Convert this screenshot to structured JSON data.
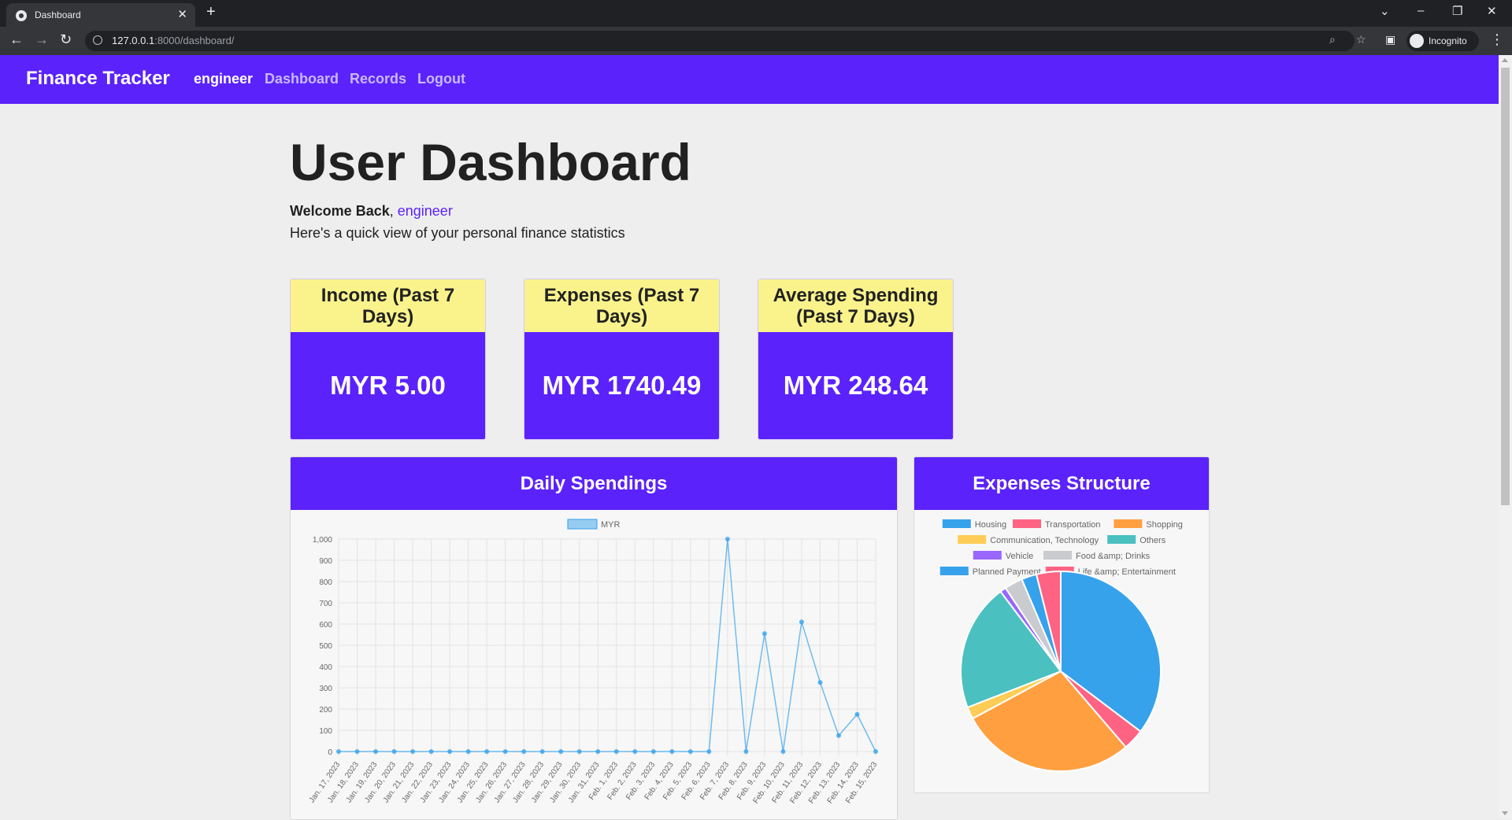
{
  "browser": {
    "tab_title": "Dashboard",
    "url_host": "127.0.0.1",
    "url_path": ":8000/dashboard/",
    "profile_label": "Incognito"
  },
  "navbar": {
    "brand": "Finance Tracker",
    "username": "engineer",
    "links": [
      "Dashboard",
      "Records",
      "Logout"
    ]
  },
  "header": {
    "title": "User Dashboard",
    "welcome_prefix": "Welcome Back",
    "welcome_user": "engineer",
    "subtitle": "Here's a quick view of your personal finance statistics"
  },
  "stats": [
    {
      "label": "Income (Past 7 Days)",
      "value": "MYR 5.00"
    },
    {
      "label": "Expenses (Past 7 Days)",
      "value": "MYR 1740.49"
    },
    {
      "label": "Average Spending (Past 7 Days)",
      "value": "MYR 248.64"
    }
  ],
  "colors": {
    "brand": "#5b22fb",
    "card_header": "#faf38c",
    "line": "#36a2eb"
  },
  "icons": {
    "back": "arrow-left-icon",
    "forward": "arrow-right-icon",
    "reload": "reload-icon",
    "zoom": "magnifier-icon",
    "bookmark": "star-icon",
    "sidepanel": "side-panel-icon",
    "menu": "kebab-menu-icon"
  },
  "chart_data": [
    {
      "type": "line",
      "title": "Daily Spendings",
      "ylim": [
        0,
        1000
      ],
      "y_ticks": [
        0,
        100,
        200,
        300,
        400,
        500,
        600,
        700,
        800,
        900,
        1000
      ],
      "grid": true,
      "legend_position": "top",
      "categories": [
        "Jan. 17, 2023",
        "Jan. 18, 2023",
        "Jan. 19, 2023",
        "Jan. 20, 2023",
        "Jan. 21, 2023",
        "Jan. 22, 2023",
        "Jan. 23, 2023",
        "Jan. 24, 2023",
        "Jan. 25, 2023",
        "Jan. 26, 2023",
        "Jan. 27, 2023",
        "Jan. 28, 2023",
        "Jan. 29, 2023",
        "Jan. 30, 2023",
        "Jan. 31, 2023",
        "Feb. 1, 2023",
        "Feb. 2, 2023",
        "Feb. 3, 2023",
        "Feb. 4, 2023",
        "Feb. 5, 2023",
        "Feb. 6, 2023",
        "Feb. 7, 2023",
        "Feb. 8, 2023",
        "Feb. 9, 2023",
        "Feb. 10, 2023",
        "Feb. 11, 2023",
        "Feb. 12, 2023",
        "Feb. 13, 2023",
        "Feb. 14, 2023",
        "Feb. 15, 2023"
      ],
      "series": [
        {
          "name": "MYR",
          "values": [
            0,
            0,
            0,
            0,
            0,
            0,
            0,
            0,
            0,
            0,
            0,
            0,
            0,
            0,
            0,
            0,
            0,
            0,
            0,
            0,
            0,
            1000,
            0,
            555,
            0,
            610,
            325,
            75,
            175,
            0
          ]
        }
      ]
    },
    {
      "type": "pie",
      "title": "Expenses Structure",
      "legend_position": "top",
      "labels": [
        "Housing",
        "Transportation",
        "Shopping",
        "Communication, Technology",
        "Others",
        "Vehicle",
        "Food &amp; Drinks",
        "Planned Payment",
        "Life &amp; Entertainment"
      ],
      "values": [
        36,
        3.5,
        29,
        2,
        21,
        1,
        3,
        2.5,
        4
      ],
      "colors": [
        "#36a2eb",
        "#ff6384",
        "#ff9f40",
        "#ffcd56",
        "#4bc0c0",
        "#9966ff",
        "#c9cbcf",
        "#36a2eb",
        "#ff6384"
      ]
    }
  ]
}
